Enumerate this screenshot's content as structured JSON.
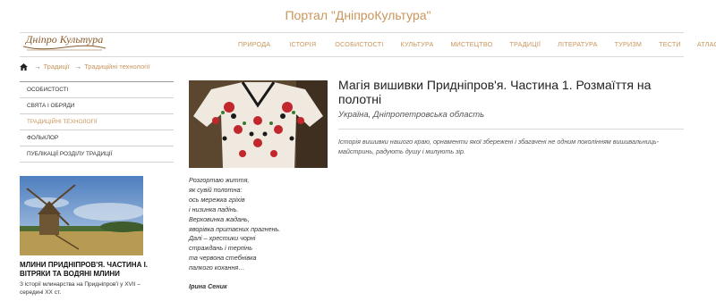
{
  "header": {
    "title": "Портал \"ДніпроКультура\""
  },
  "logo": {
    "text": "Дніпро Культура"
  },
  "nav": {
    "items": [
      "ПРИРОДА",
      "ІСТОРІЯ",
      "ОСОБИСТОСТІ",
      "КУЛЬТУРА",
      "МИСТЕЦТВО",
      "ТРАДИЦІЇ",
      "ЛІТЕРАТУРА",
      "ТУРИЗМ",
      "ТЕСТИ",
      "АТЛАС"
    ]
  },
  "breadcrumb": {
    "sep": "→",
    "item1": "Традиції",
    "item2": "Традиційні технології"
  },
  "sidebar": {
    "items": [
      "ОСОБИСТОСТІ",
      "СВЯТА І ОБРЯДИ",
      "ТРАДИЦІЙНІ ТЕХНОЛОГІЇ",
      "ФОЛЬКЛОР",
      "ПУБЛІКАЦІЇ РОЗДІЛУ ТРАДИЦІЇ"
    ]
  },
  "promo": {
    "title": "МЛИНИ ПРИДНІПРОВ'Я. ЧАСТИНА І. ВІТРЯКИ ТА ВОДЯНІ МЛИНИ",
    "desc": "З історії млинарства на Придніпров'ї у XVII – середині XX ст."
  },
  "article": {
    "title": "Магія вишивки Придніпров'я. Частина 1. Розмаїття на полотні",
    "location": "Україна, Дніпропетровська область",
    "intro": "Історія вишивки нашого краю, орнаменти якої збережені і збагачені не одним поколінням вишивальниць-майстринь, радують душу і милують зір.",
    "poem": [
      "Розгортаю життя,",
      "як сувій полотна:",
      "ось мережка гріхів",
      "і низинка падінь.",
      "Верховинка жадань,",
      "яворівка притаєних прагнень.",
      "Далі – хрестики чорні",
      "страждань і терпінь",
      "та червона стебнівка",
      "палкого кохання…"
    ],
    "author": "Ірина Сеник"
  },
  "colors": {
    "accent": "#c9955a",
    "text": "#333333",
    "divider": "#d0d0d0"
  }
}
